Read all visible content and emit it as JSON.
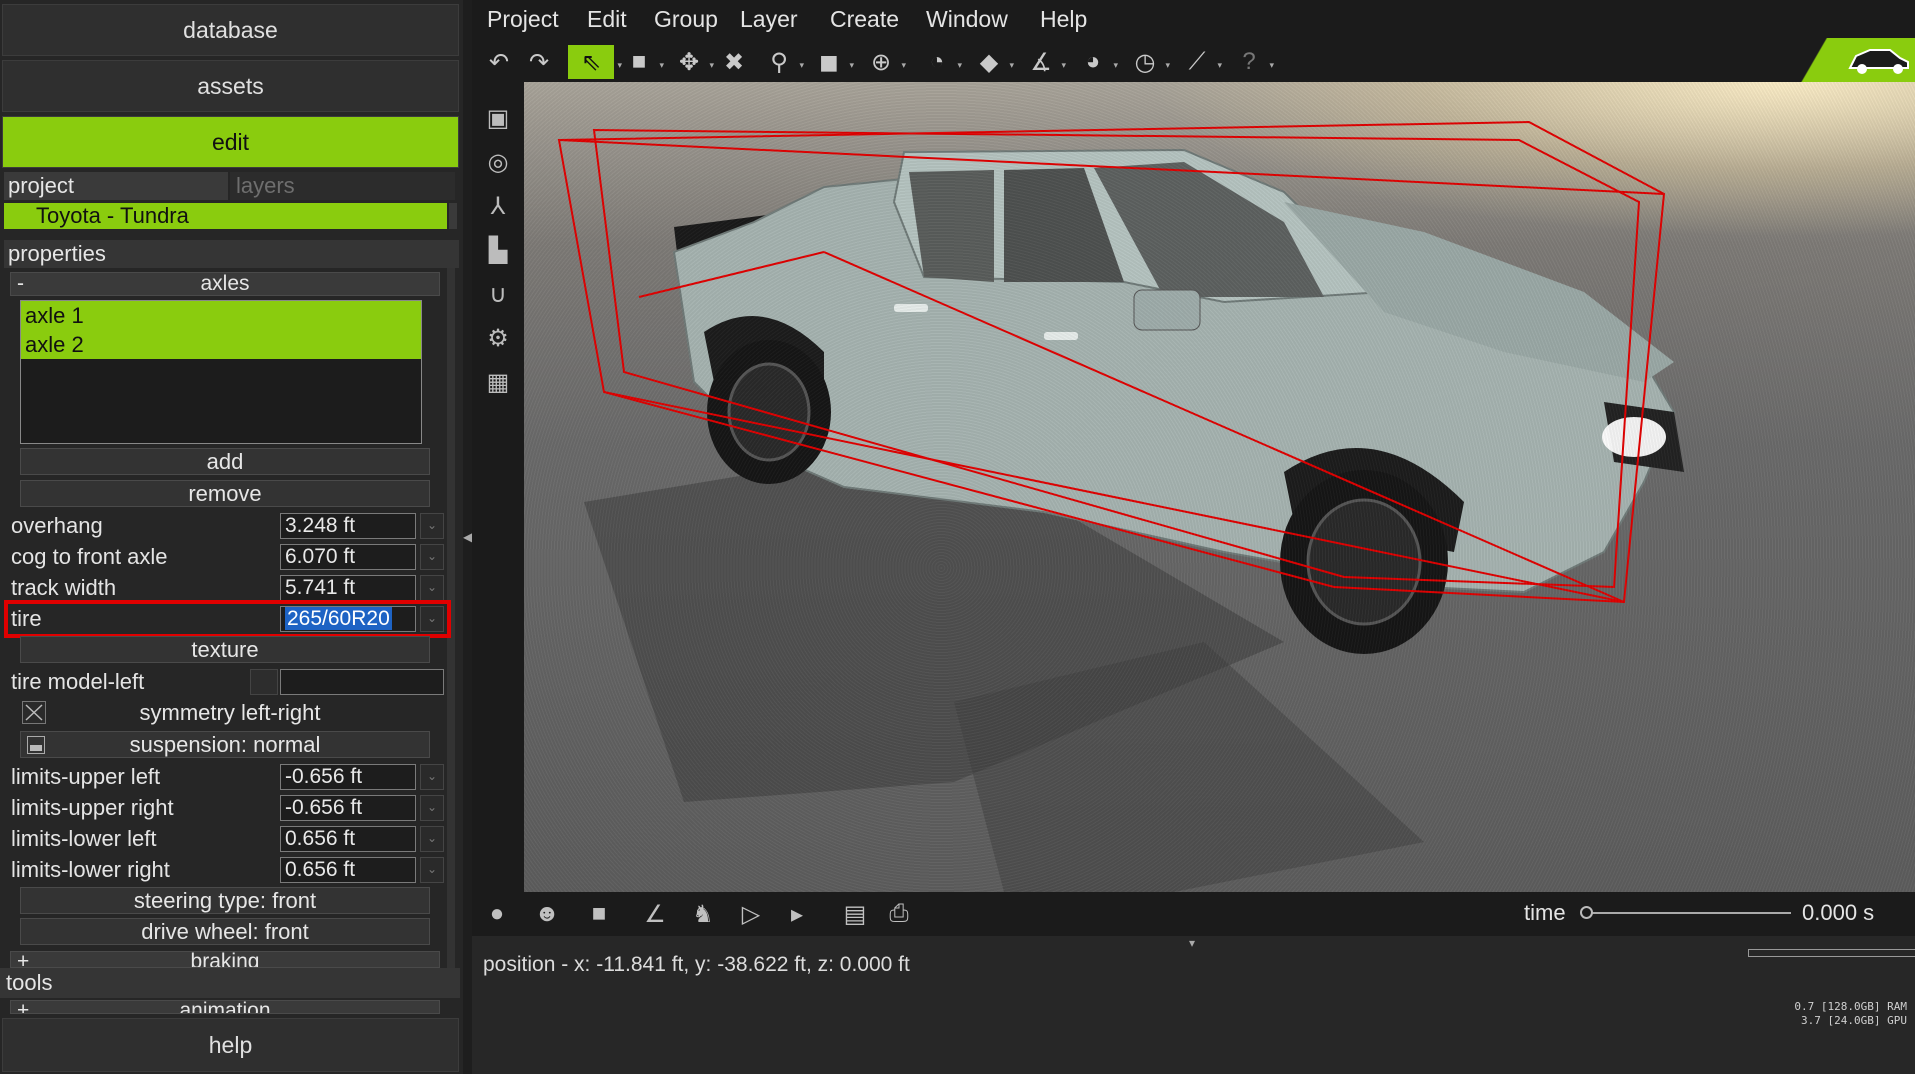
{
  "left_panel": {
    "database_label": "database",
    "assets_label": "assets",
    "edit_label": "edit",
    "tabs": {
      "project": "project",
      "layers": "layers"
    },
    "project_item": "Toyota - Tundra",
    "properties_label": "properties",
    "axles_section": {
      "sign": "-",
      "label": "axles"
    },
    "axles": [
      "axle 1",
      "axle 2"
    ],
    "add_label": "add",
    "remove_label": "remove",
    "fields": {
      "overhang": {
        "label": "overhang",
        "value": "3.248 ft"
      },
      "cog": {
        "label": "cog to front axle",
        "value": "6.070 ft"
      },
      "track": {
        "label": "track width",
        "value": "5.741 ft"
      },
      "tire": {
        "label": "tire",
        "value": "265/60R20"
      }
    },
    "texture_label": "texture",
    "tire_model_left_label": "tire model-left",
    "tire_model_left_value": "",
    "symmetry_label": "symmetry left-right",
    "suspension_label": "suspension: normal",
    "limits": {
      "upper_left": {
        "label": "limits-upper left",
        "value": "-0.656 ft"
      },
      "upper_right": {
        "label": "limits-upper right",
        "value": "-0.656 ft"
      },
      "lower_left": {
        "label": "limits-lower left",
        "value": "0.656 ft"
      },
      "lower_right": {
        "label": "limits-lower right",
        "value": "0.656 ft"
      }
    },
    "steering_label": "steering type: front",
    "drive_label": "drive wheel: front",
    "braking_section": {
      "sign": "+",
      "label": "braking"
    },
    "tools_label": "tools",
    "animation_section": {
      "sign": "+",
      "label": "animation"
    },
    "help_label": "help"
  },
  "menubar": [
    "Project",
    "Edit",
    "Group",
    "Layer",
    "Create",
    "Window",
    "Help"
  ],
  "toolbar_icons": [
    "undo-icon",
    "redo-icon",
    "select-arrow-icon",
    "box-select-icon",
    "transform-icon",
    "delete-icon",
    "zoom-icon",
    "cube-icon",
    "move-icon",
    "gauge-icon",
    "plane-icon",
    "axis-icon",
    "dial-icon",
    "speedometer-icon",
    "ruler-icon",
    "help-icon"
  ],
  "bottom_bar": {
    "time_label": "time",
    "time_value": "0.000 s",
    "time_progress": 0
  },
  "status": {
    "position_text": "position - x: -11.841 ft, y: -38.622 ft, z: 0.000 ft",
    "ram_text": "0.7 [128.0GB] RAM",
    "gpu_text": "3.7 [24.0GB] GPU"
  },
  "colors": {
    "accent_green": "#8acc0e",
    "highlight_red": "#e00000",
    "selection_blue": "#1e63c4",
    "car_body": "#a6b4b1"
  }
}
